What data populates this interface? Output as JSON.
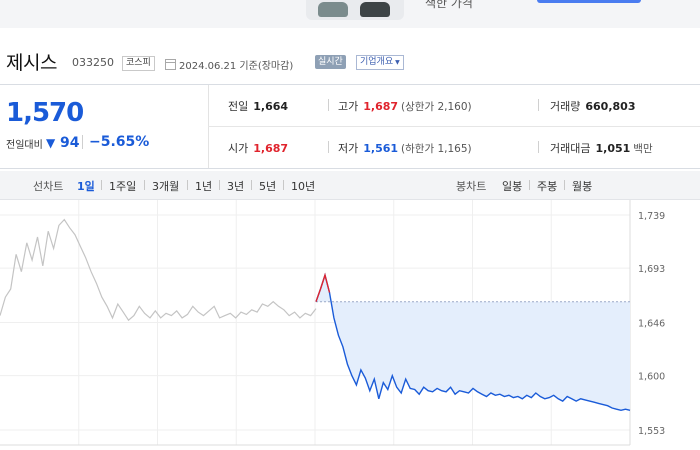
{
  "ad": {
    "caption": "색한 가격"
  },
  "stock": {
    "name": "제시스",
    "code": "033250",
    "market_badge": "코스피",
    "date_text": "2024.06.21 기준(장마감)",
    "realtime_badge": "실시간",
    "overview_label": "기업개요"
  },
  "price": {
    "current": "1,570",
    "compare_label": "전일대비",
    "direction_symbol": "▼",
    "change_amount": "94",
    "change_rate": "−5.65%"
  },
  "quote": {
    "prev_close_label": "전일",
    "prev_close": "1,664",
    "high_label": "고가",
    "high": "1,687",
    "upper_limit": "(상한가 2,160)",
    "volume_label": "거래량",
    "volume": "660,803",
    "open_label": "시가",
    "open": "1,687",
    "low_label": "저가",
    "low": "1,561",
    "lower_limit": "(하한가 1,165)",
    "amount_label": "거래대금",
    "amount": "1,051",
    "amount_unit": "백만"
  },
  "periods": {
    "line_label": "선차트",
    "line_items": [
      "1일",
      "1주일",
      "3개월",
      "1년",
      "3년",
      "5년",
      "10년"
    ],
    "active_index": 0,
    "candle_label": "봉차트",
    "candle_items": [
      "일봉",
      "주봉",
      "월봉"
    ]
  },
  "colors": {
    "up": "#e0242d",
    "down": "#1a5bd8",
    "prev_session_line": "#c4c4c4",
    "fill": "#e4eefc"
  },
  "chart_data": {
    "type": "line",
    "ylim": [
      1540,
      1752
    ],
    "y_ticks": [
      "1,739",
      "1,693",
      "1,646",
      "1,600",
      "1,553"
    ],
    "y_tick_values": [
      1739,
      1693,
      1646,
      1600,
      1553
    ],
    "reference_price": 1664,
    "series": [
      {
        "values": [
          1652,
          1668,
          1675,
          1705,
          1690,
          1715,
          1700,
          1720,
          1695,
          1725,
          1710,
          1730,
          1735,
          1728,
          1722,
          1712,
          1702,
          1690,
          1680,
          1668,
          1660,
          1650,
          1662,
          1655,
          1648,
          1652,
          1660,
          1654,
          1650,
          1656,
          1650,
          1654,
          1652,
          1656,
          1650,
          1653,
          1660,
          1655,
          1652,
          1656,
          1660,
          1650,
          1652,
          1654,
          1650,
          1655,
          1653,
          1657,
          1655,
          1662,
          1660,
          1664,
          1660,
          1657,
          1652,
          1655,
          1650,
          1654,
          1652,
          1658
        ]
      },
      {
        "values": [
          1664,
          1675,
          1687,
          1672,
          1650,
          1635,
          1625,
          1610,
          1600,
          1592,
          1605,
          1598,
          1587,
          1597,
          1580,
          1594,
          1588,
          1600,
          1590,
          1585,
          1597,
          1589,
          1588,
          1584,
          1590,
          1587,
          1586,
          1589,
          1587,
          1586,
          1590,
          1584,
          1587,
          1586,
          1585,
          1589,
          1586,
          1584,
          1582,
          1585,
          1583,
          1584,
          1582,
          1583,
          1581,
          1582,
          1580,
          1583,
          1581,
          1585,
          1582,
          1580,
          1581,
          1583,
          1580,
          1578,
          1582,
          1580,
          1578,
          1580,
          1579,
          1578,
          1577,
          1576,
          1575,
          1574,
          1572,
          1571,
          1570,
          1571,
          1570
        ]
      }
    ]
  }
}
